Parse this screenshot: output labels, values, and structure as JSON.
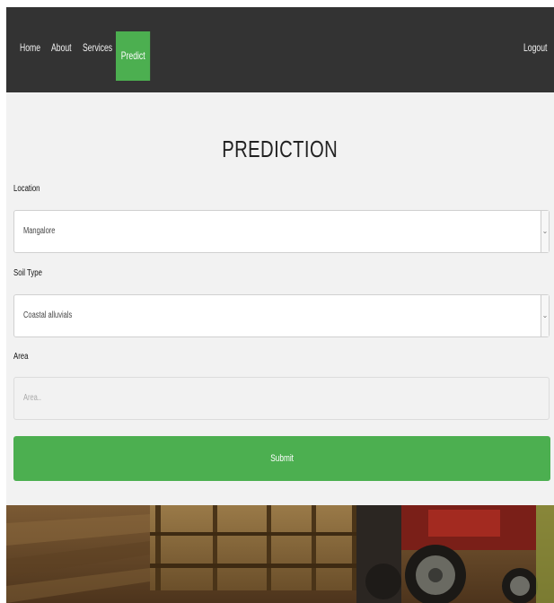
{
  "nav": {
    "items": [
      {
        "label": "Home"
      },
      {
        "label": "About"
      },
      {
        "label": "Services"
      },
      {
        "label": "Predict"
      }
    ],
    "logout_label": "Logout",
    "active_color": "#4caf50",
    "bar_color": "#333333"
  },
  "main": {
    "title": "PREDICTION",
    "location": {
      "label": "Location",
      "value": "Mangalore"
    },
    "soil": {
      "label": "Soil Type",
      "value": "Coastal alluvials"
    },
    "area": {
      "label": "Area",
      "placeholder": "Area.."
    },
    "submit_label": "Submit",
    "accent_color": "#4caf50"
  },
  "background_image": {
    "subject": "tractor-with-trailer-on-farm-field"
  }
}
